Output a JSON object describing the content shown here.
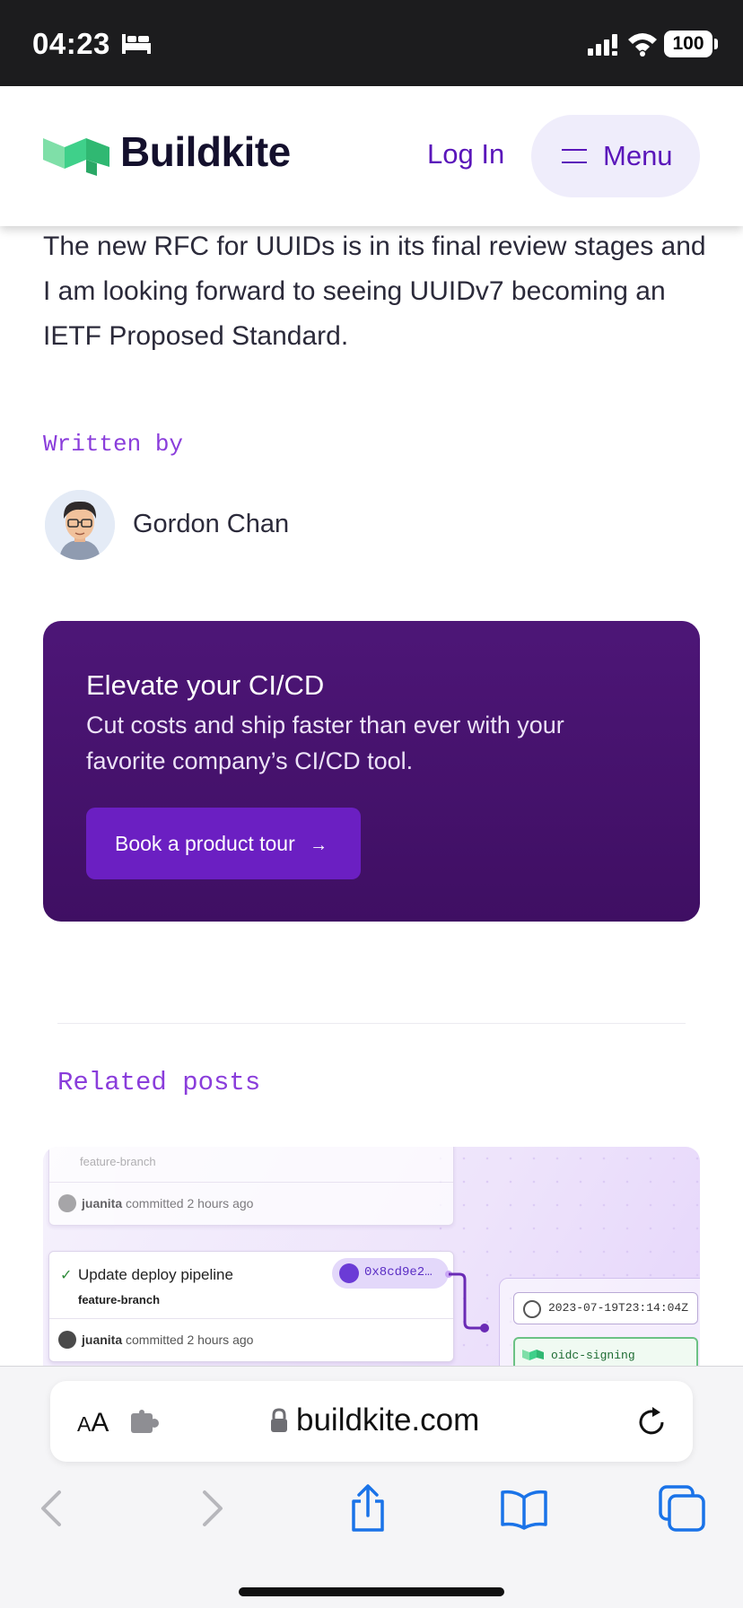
{
  "status_bar": {
    "time": "04:23",
    "battery": "100",
    "icons": [
      "bed-icon",
      "signal-icon",
      "wifi-icon",
      "battery-icon"
    ]
  },
  "header": {
    "logo_text": "Buildkite",
    "login_label": "Log In",
    "menu_label": "Menu"
  },
  "article": {
    "paragraph": "The new RFC for UUIDs is in its final review stages and I am looking forward to seeing UUIDv7 becoming an IETF Proposed Standard.",
    "written_by_label": "Written by",
    "author_name": "Gordon Chan"
  },
  "cta": {
    "title": "Elevate your CI/CD",
    "description": "Cut costs and ship faster than ever with your favorite company’s CI/CD tool.",
    "button_label": "Book a product tour",
    "button_arrow": "→"
  },
  "related": {
    "heading": "Related posts",
    "image": {
      "branch_top": "feature-branch",
      "commit_user": "juanita",
      "commit_suffix": "committed 2 hours ago",
      "commit_title": "Update deploy pipeline",
      "branch": "feature-branch",
      "commit_user_2": "juanita",
      "commit_suffix_2": "committed 2 hours ago",
      "hash": "0x8cd9e2…",
      "timestamp": "2023-07-19T23:14:04Z",
      "step_name": "oidc-signing"
    }
  },
  "browser": {
    "text_size_label_small": "A",
    "text_size_label_large": "A",
    "url": "buildkite.com",
    "nav": [
      "back-icon",
      "forward-icon",
      "share-icon",
      "bookmarks-icon",
      "tabs-icon"
    ]
  },
  "colors": {
    "brand_purple": "#5a16ba",
    "accent_mono": "#8a3ddb",
    "cta_bg": "#4d1677",
    "cta_button": "#6b1fc2",
    "logo_green": "#3fd08a"
  }
}
